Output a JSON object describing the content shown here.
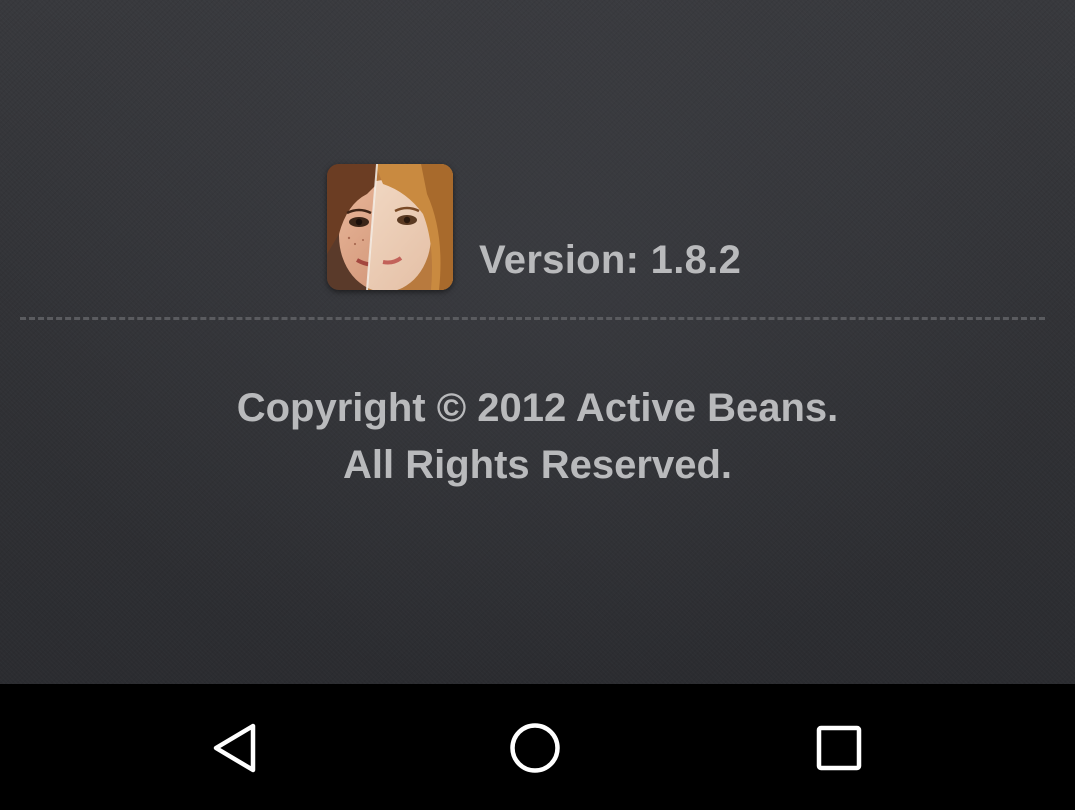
{
  "about": {
    "version_label": "Version: 1.8.2",
    "copyright_line1": "Copyright © 2012 Active Beans.",
    "copyright_line2": "All Rights Reserved."
  },
  "app_icon": {
    "semantic": "face-split-photo-icon"
  },
  "navigation_bar": {
    "buttons": [
      {
        "name": "back",
        "icon": "back-triangle-icon"
      },
      {
        "name": "home",
        "icon": "home-circle-icon"
      },
      {
        "name": "recents",
        "icon": "recents-square-icon"
      }
    ]
  },
  "colors": {
    "background": "#333438",
    "text": "#b9babc",
    "divider": "#5a5b5f",
    "navbar": "#000000",
    "nav_icon": "#ffffff"
  }
}
